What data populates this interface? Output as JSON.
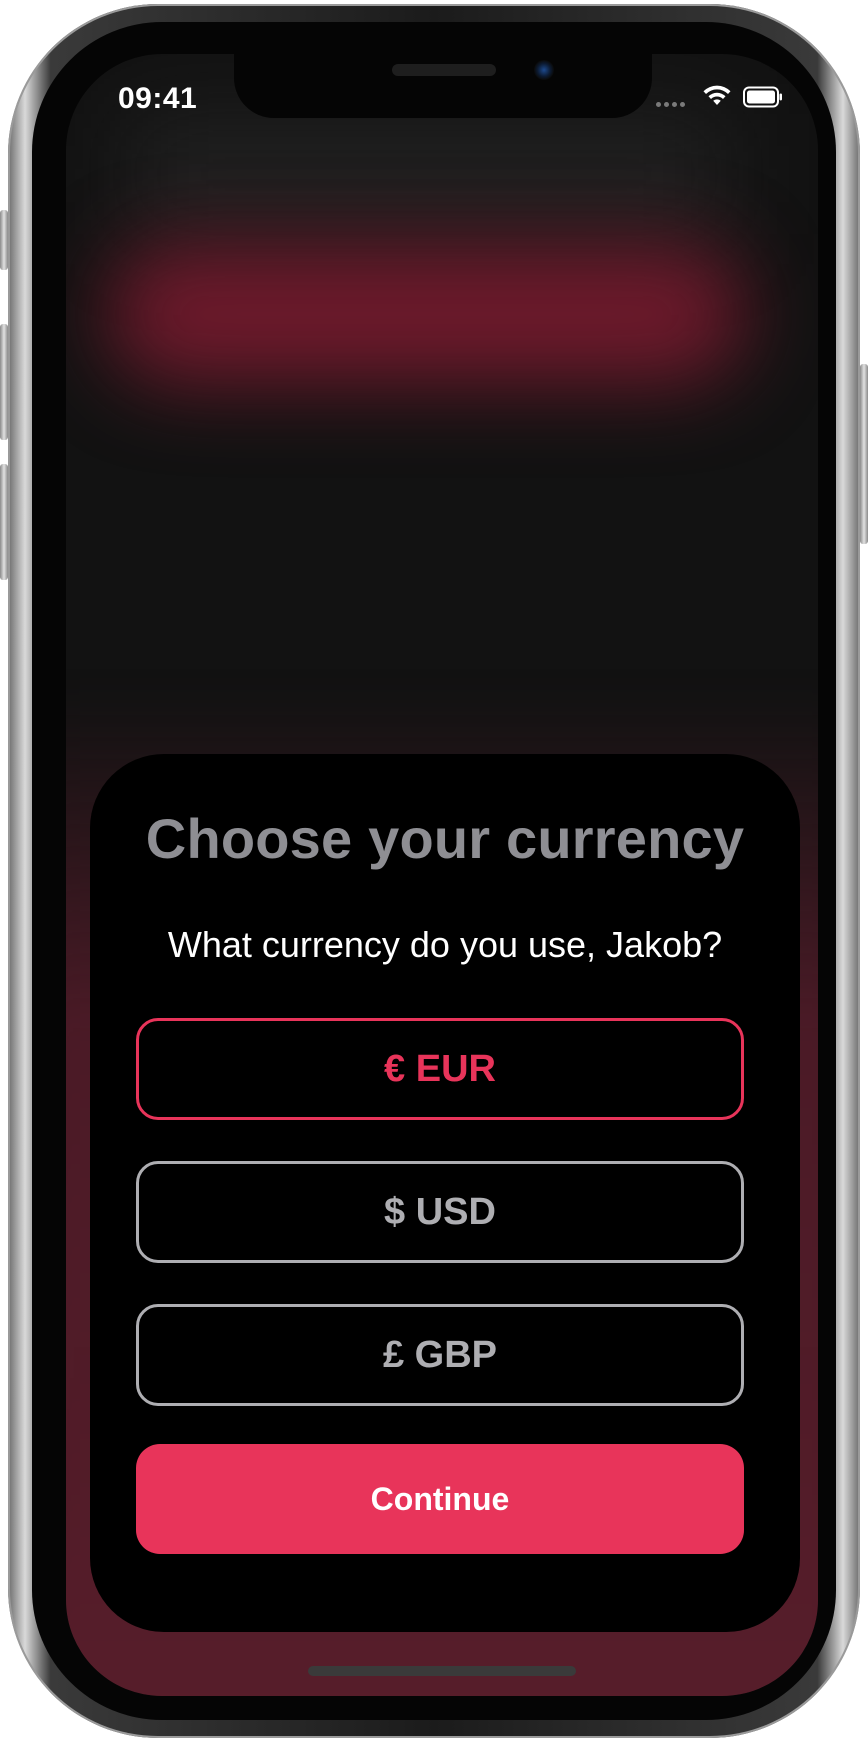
{
  "status_bar": {
    "time": "09:41"
  },
  "sheet": {
    "title": "Choose your currency",
    "subtitle": "What currency do you use, Jakob?",
    "options": [
      {
        "label": "€ EUR",
        "selected": true
      },
      {
        "label": "$ USD",
        "selected": false
      },
      {
        "label": "£ GBP",
        "selected": false
      }
    ],
    "continue_label": "Continue"
  },
  "colors": {
    "accent": "#e8345a",
    "option_border": "#aeaeb2",
    "title_gray": "#8e8e93",
    "sheet_background": "#000000"
  },
  "icons": [
    "wifi-icon",
    "battery-icon",
    "cellular-signal-icon"
  ]
}
